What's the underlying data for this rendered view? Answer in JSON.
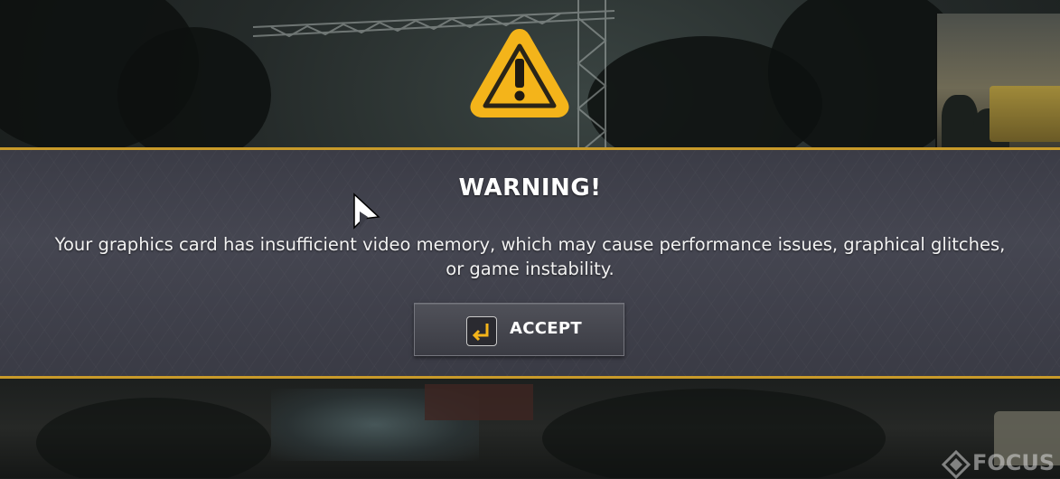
{
  "dialog": {
    "title": "WARNING!",
    "message": "Your graphics card has insufficient video memory, which may cause performance issues, graphical glitches, or game instability.",
    "accept_label": "ACCEPT"
  },
  "watermark": {
    "text": "FOCUS"
  },
  "icons": {
    "warning": "warning-triangle-icon",
    "enter_key": "enter-key-icon",
    "cursor": "mouse-cursor-icon"
  },
  "colors": {
    "accent_gold": "#c89a2a",
    "warning_yellow": "#f4b41a",
    "band_bg": "#42434e",
    "text": "#ffffff"
  }
}
